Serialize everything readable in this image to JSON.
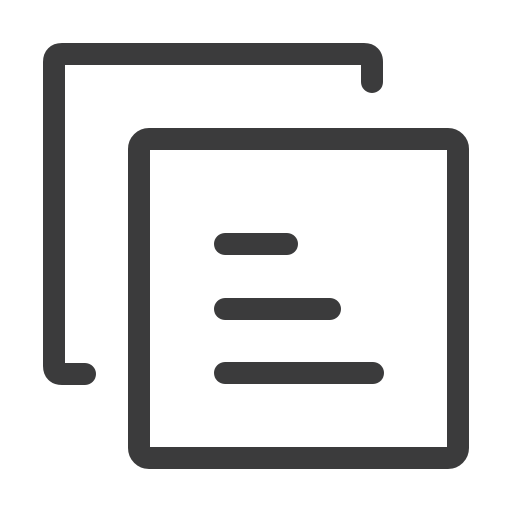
{
  "icon": {
    "name": "copy-document-icon",
    "stroke_color": "#3b3b3c",
    "background_color": "#ffffff"
  }
}
